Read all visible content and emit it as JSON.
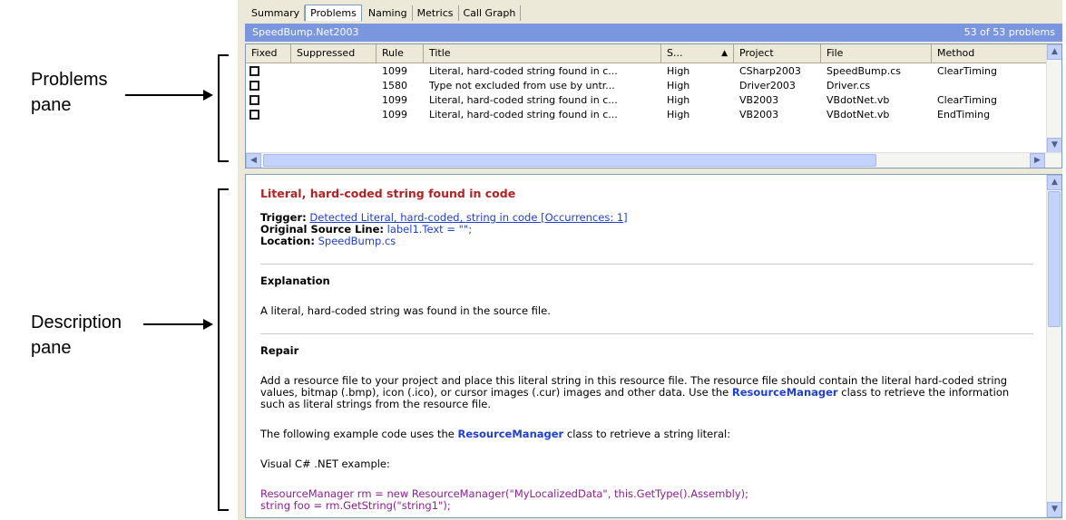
{
  "callouts": {
    "problems_line1": "Problems",
    "problems_line2": "pane",
    "description_line1": "Description",
    "description_line2": "pane"
  },
  "tabs": [
    {
      "label": "Summary",
      "active": false
    },
    {
      "label": "Problems",
      "active": true
    },
    {
      "label": "Naming",
      "active": false
    },
    {
      "label": "Metrics",
      "active": false
    },
    {
      "label": "Call Graph",
      "active": false
    }
  ],
  "titlebar": {
    "name": "SpeedBump.Net2003",
    "count": "53 of 53 problems"
  },
  "grid": {
    "columns": [
      "Fixed",
      "Suppressed",
      "Rule",
      "Title",
      "S...",
      "Project",
      "File",
      "Method"
    ],
    "sort_indicator": "▲",
    "rows": [
      {
        "rule": "1099",
        "title": "Literal, hard-coded string found in c...",
        "severity": "High",
        "project": "CSharp2003",
        "file": "SpeedBump.cs",
        "method": "ClearTiming"
      },
      {
        "rule": "1580",
        "title": "Type not excluded from use by untr...",
        "severity": "High",
        "project": "Driver2003",
        "file": "Driver.cs",
        "method": ""
      },
      {
        "rule": "1099",
        "title": "Literal, hard-coded string found in c...",
        "severity": "High",
        "project": "VB2003",
        "file": "VBdotNet.vb",
        "method": "ClearTiming"
      },
      {
        "rule": "1099",
        "title": "Literal, hard-coded string found in c...",
        "severity": "High",
        "project": "VB2003",
        "file": "VBdotNet.vb",
        "method": "EndTiming"
      }
    ]
  },
  "description": {
    "title": "Literal, hard-coded string found in code",
    "trigger_label": "Trigger:",
    "trigger_value": "Detected Literal, hard-coded, string in code [Occurrences: 1]",
    "source_label": "Original Source Line:",
    "source_value": "label1.Text = \"\";",
    "location_label": "Location:",
    "location_value": "SpeedBump.cs",
    "explanation_head": "Explanation",
    "explanation_text": "A literal, hard-coded string was found in the source file.",
    "repair_head": "Repair",
    "repair_text_1": "Add a resource file to your project and place this literal string in this resource file. The resource file should contain the literal hard-coded string values, bitmap (.bmp), icon (.ico), or cursor images (.cur) images and other data. Use the",
    "repair_kw_1": "ResourceManager",
    "repair_text_2": "class to retrieve the information such as literal strings from the resource file.",
    "example_text_1": "The following example code uses the",
    "example_kw": "ResourceManager",
    "example_text_2": "class to retrieve a string literal:",
    "visual_label": "Visual C# .NET example:",
    "code_line_1": "ResourceManager rm = new ResourceManager(\"MyLocalizedData\", this.GetType().Assembly);",
    "code_line_2": "string foo = rm.GetString(\"string1\");"
  },
  "icons": {
    "scroll_up": "up-arrow-icon",
    "scroll_down": "down-arrow-icon",
    "scroll_left": "left-arrow-icon",
    "scroll_right": "right-arrow-icon"
  }
}
